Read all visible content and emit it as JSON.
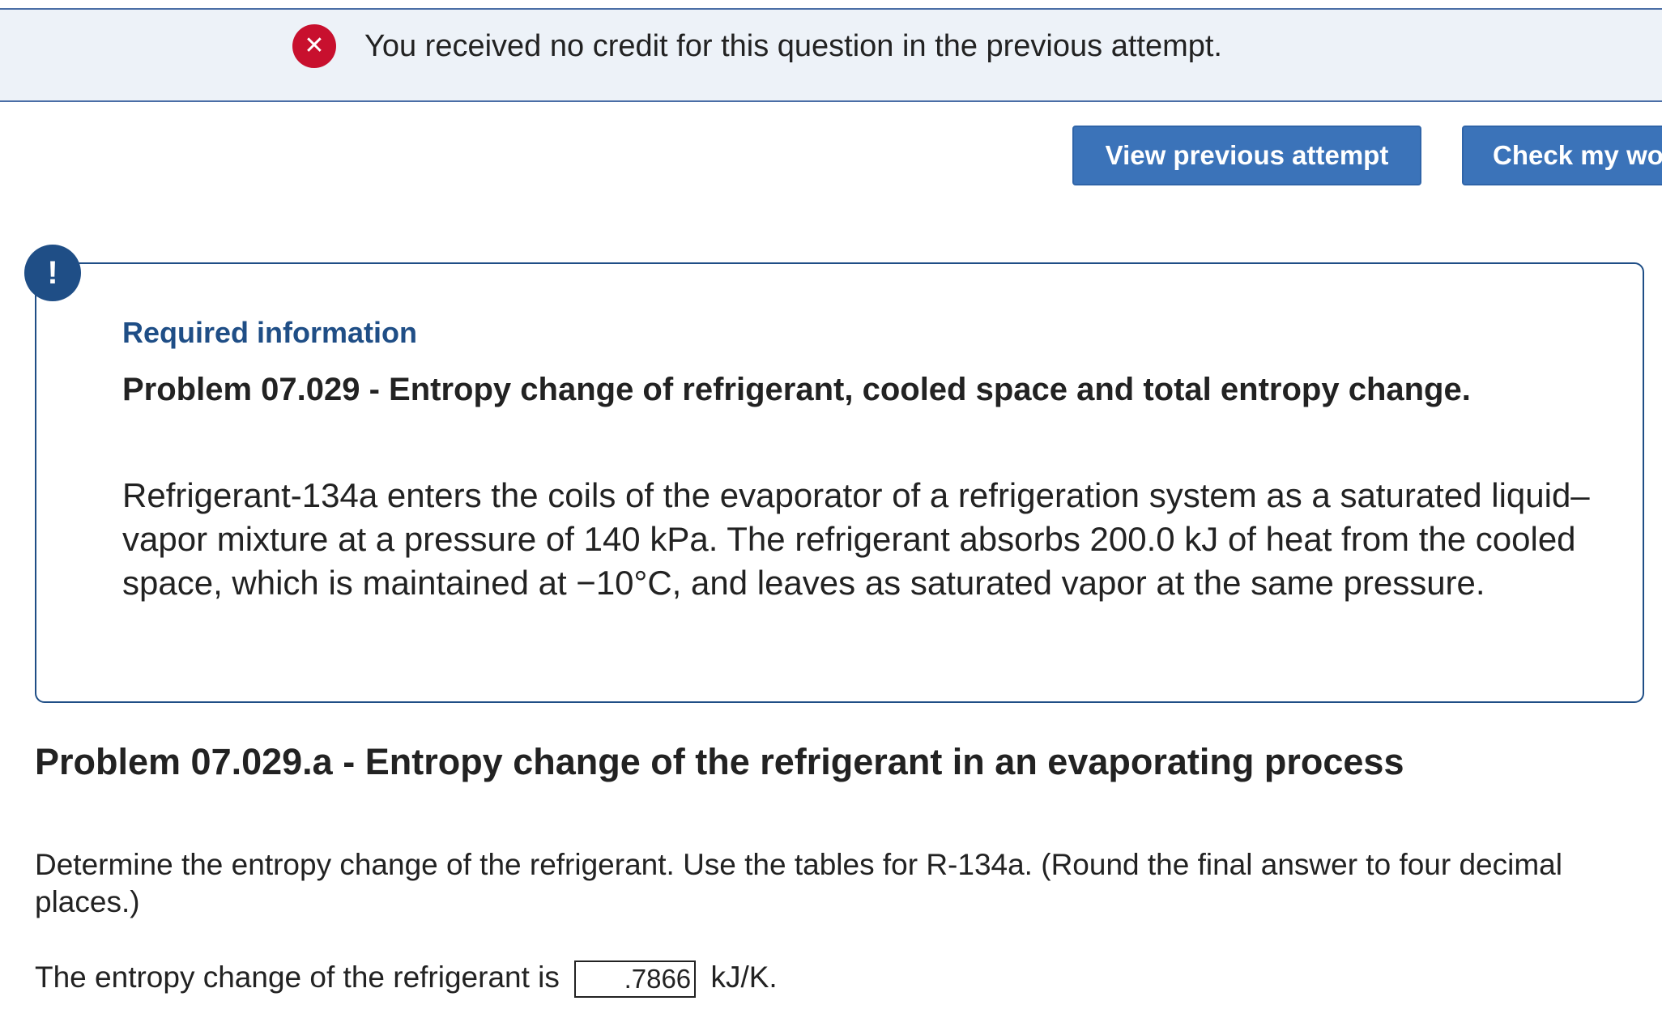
{
  "banner": {
    "icon": "close-circle-icon",
    "icon_glyph": "✕",
    "message": "You received no credit for this question in the previous attempt."
  },
  "toolbar": {
    "view_previous_label": "View previous attempt",
    "check_work_label": "Check my wo"
  },
  "info": {
    "icon": "exclamation-icon",
    "icon_glyph": "!",
    "required_title": "Required information",
    "problem_title": "Problem 07.029 - Entropy change of refrigerant, cooled space and total entropy change.",
    "problem_body": "Refrigerant-134a enters the coils of the evaporator of a refrigeration system as a saturated liquid–vapor mixture at a pressure of 140 kPa. The refrigerant absorbs 200.0 kJ of heat from the cooled space, which is maintained at −10°C, and leaves as saturated vapor at the same pressure."
  },
  "part_a": {
    "heading": "Problem 07.029.a - Entropy change of the refrigerant in an evaporating process",
    "instructions": "Determine the entropy change of the refrigerant. Use the tables for R-134a. (Round the final answer to four decimal places.)",
    "answer_prefix": "The entropy change of the refrigerant is",
    "answer_value": ".7866",
    "answer_unit": "kJ/K."
  },
  "colors": {
    "banner_bg": "#edf2f8",
    "error_red": "#c8102e",
    "button_blue": "#3b73b9",
    "info_navy": "#1f4e86"
  }
}
